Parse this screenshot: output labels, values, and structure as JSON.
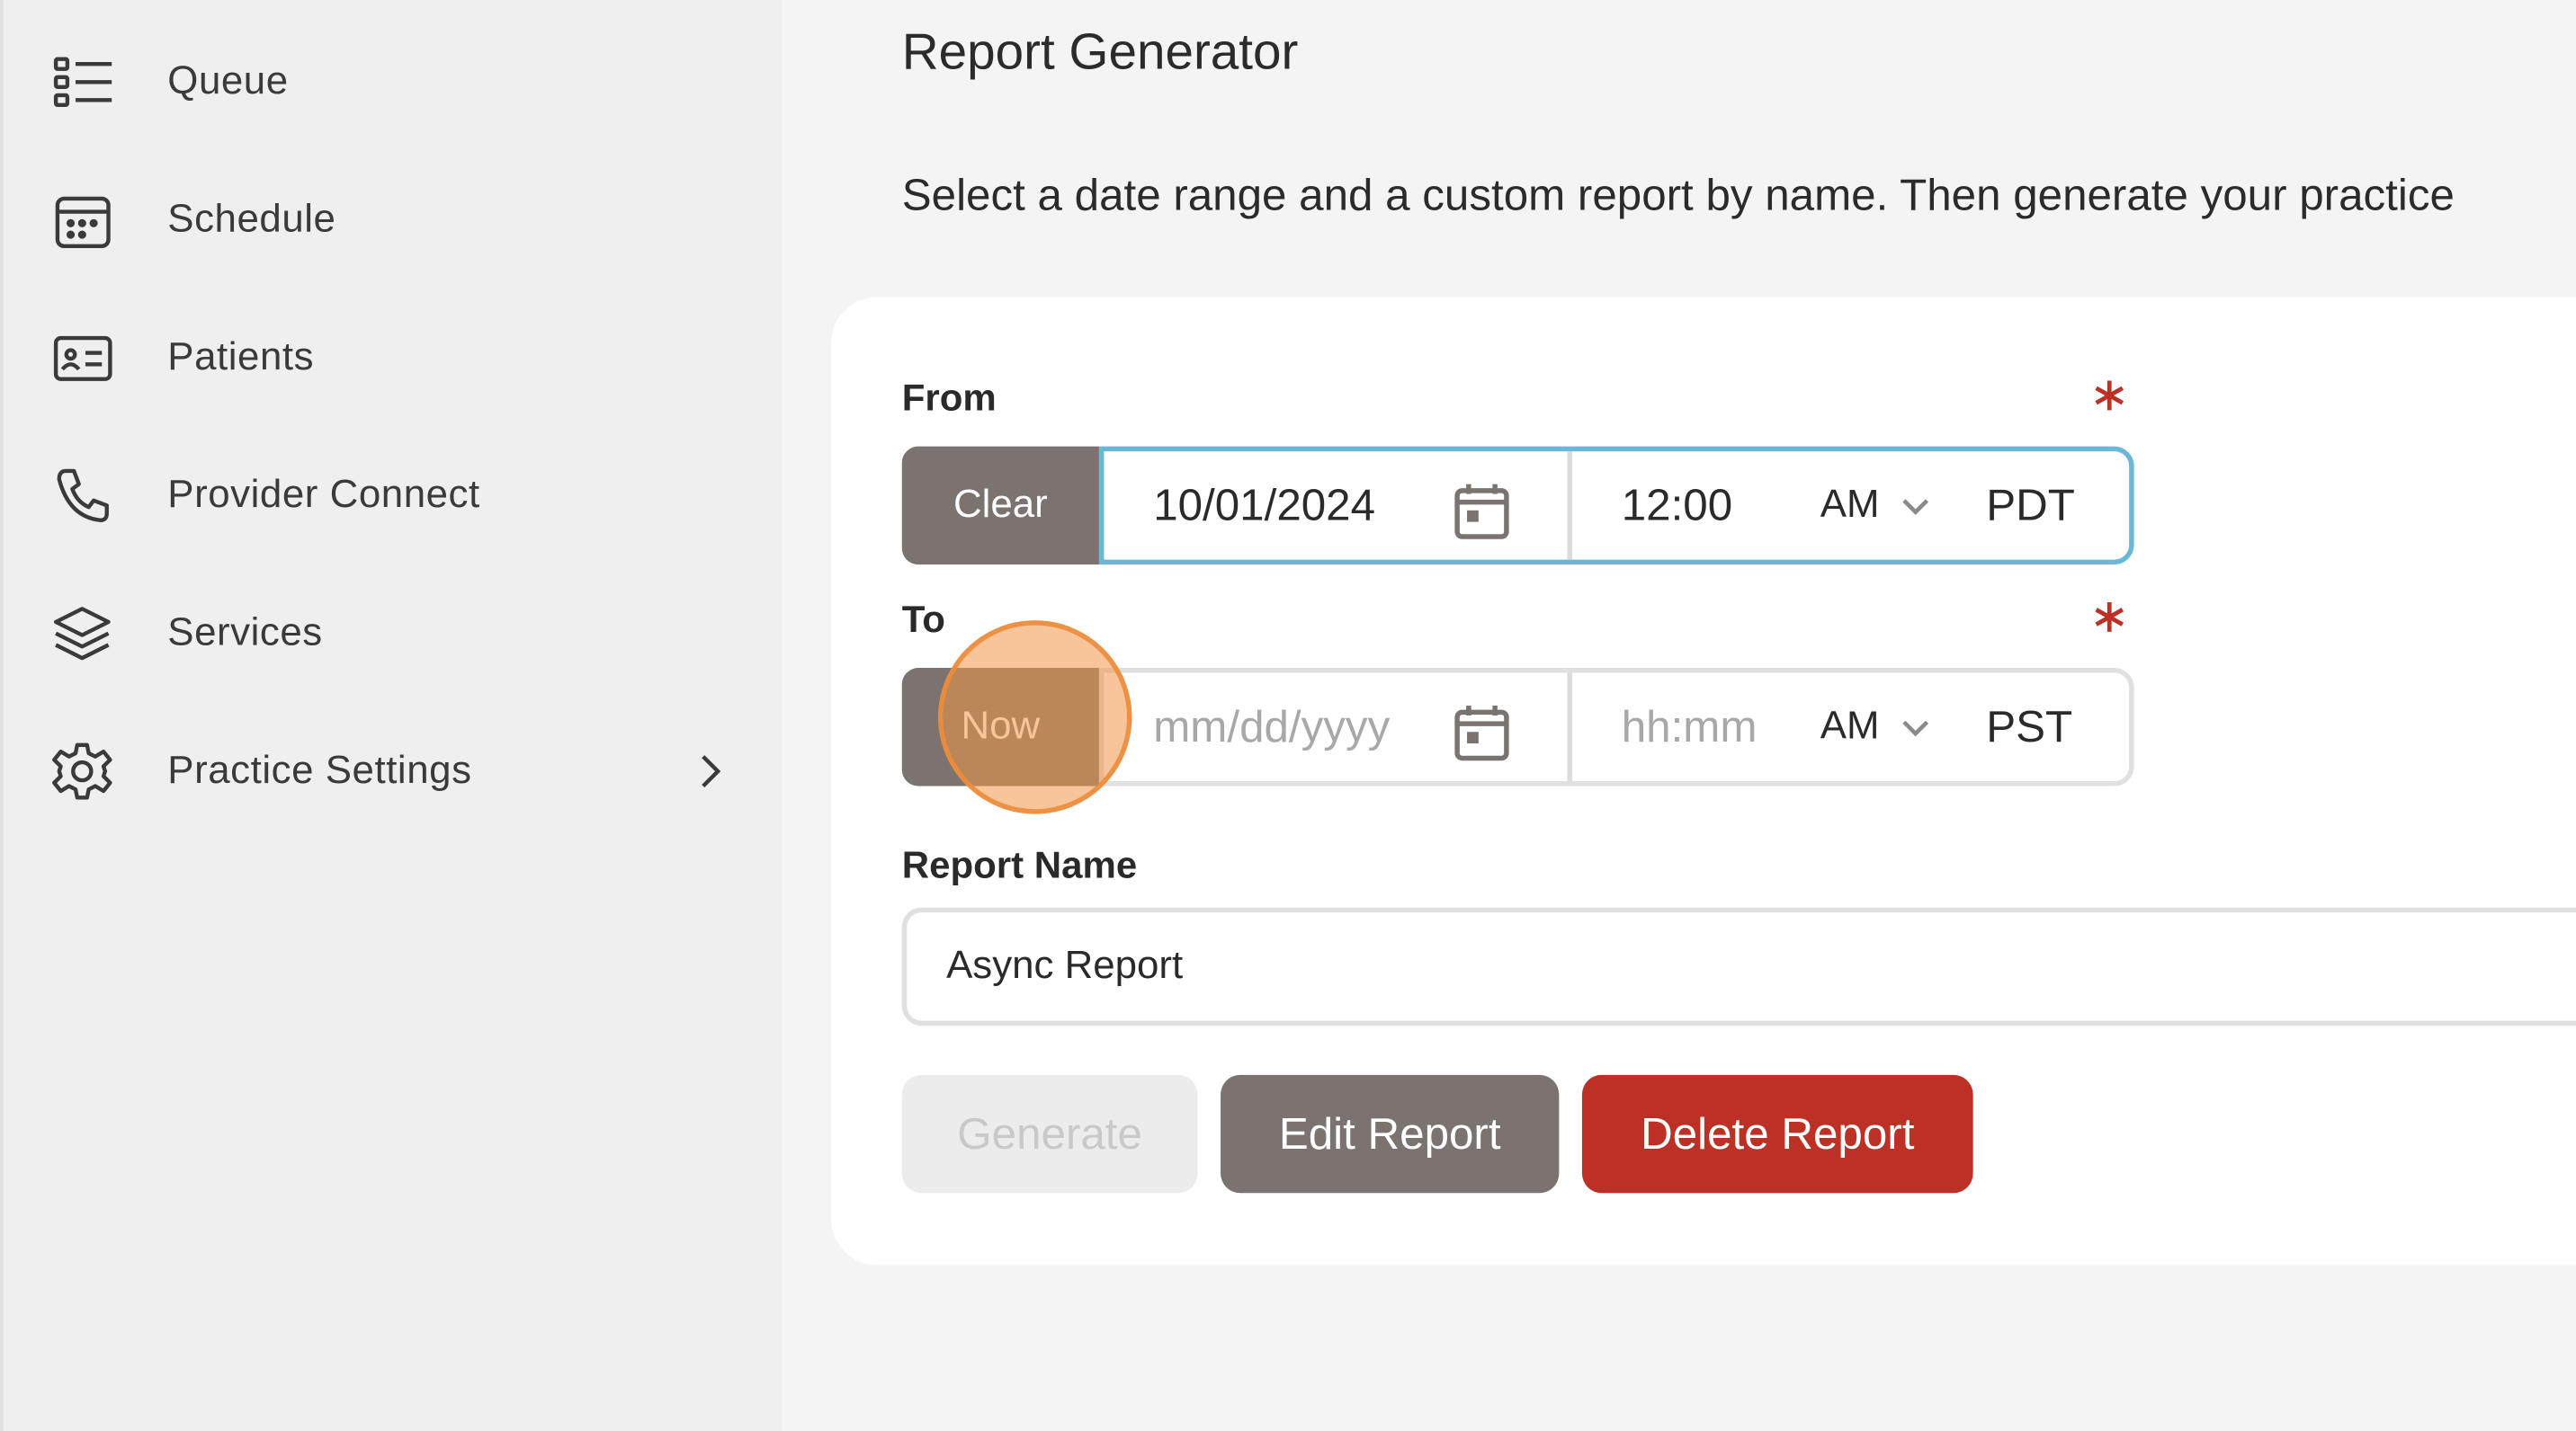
{
  "sidebar": {
    "items": [
      {
        "label": "Queue",
        "icon": "list-icon"
      },
      {
        "label": "Schedule",
        "icon": "calendar-icon"
      },
      {
        "label": "Patients",
        "icon": "id-card-icon"
      },
      {
        "label": "Provider Connect",
        "icon": "phone-icon"
      },
      {
        "label": "Services",
        "icon": "layers-icon"
      },
      {
        "label": "Practice Settings",
        "icon": "gear-icon"
      }
    ]
  },
  "main": {
    "title": "Report Generator",
    "description": "Select a date range and a custom report by name. Then generate your practice"
  },
  "form": {
    "from": {
      "label": "From",
      "button": "Clear",
      "date": "10/01/2024",
      "time": "12:00",
      "ampm": "AM",
      "timezone": "PDT"
    },
    "to": {
      "label": "To",
      "button": "Now",
      "date_placeholder": "mm/dd/yyyy",
      "time_placeholder": "hh:mm",
      "ampm": "AM",
      "timezone": "PST"
    },
    "report_name": {
      "label": "Report Name",
      "value": "Async Report"
    },
    "buttons": {
      "generate": "Generate",
      "edit": "Edit Report",
      "delete": "Delete Report"
    }
  },
  "colors": {
    "accent_blue": "#6ab7d8",
    "required_red": "#bd3025",
    "button_gray": "#7a7370",
    "click_marker": "#f0964 6"
  }
}
